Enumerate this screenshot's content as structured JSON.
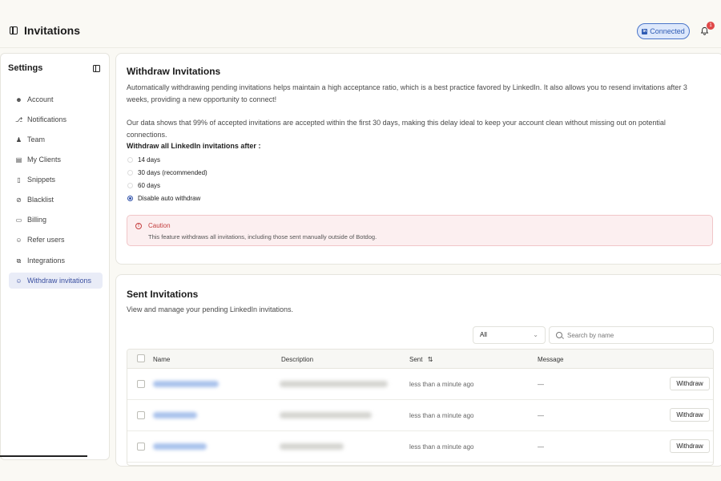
{
  "header": {
    "title": "Invitations",
    "connected_label": "Connected",
    "notification_count": "1"
  },
  "sidebar": {
    "title": "Settings",
    "items": [
      {
        "label": "Account",
        "icon": "user-icon"
      },
      {
        "label": "Notifications",
        "icon": "bell-icon"
      },
      {
        "label": "Team",
        "icon": "team-icon"
      },
      {
        "label": "My Clients",
        "icon": "clients-icon"
      },
      {
        "label": "Snippets",
        "icon": "snippet-icon"
      },
      {
        "label": "Blacklist",
        "icon": "ban-icon"
      },
      {
        "label": "Billing",
        "icon": "card-icon"
      },
      {
        "label": "Refer users",
        "icon": "user-plus-icon"
      },
      {
        "label": "Integrations",
        "icon": "integrations-icon"
      },
      {
        "label": "Withdraw invitations",
        "icon": "user-minus-icon",
        "active": true
      }
    ]
  },
  "withdraw": {
    "title": "Withdraw Invitations",
    "para1": "Automatically withdrawing pending invitations helps maintain a high acceptance ratio, which is a best practice favored by LinkedIn. It also allows you to resend invitations after 3 weeks, providing a new opportunity to connect!",
    "para2": "Our data shows that 99% of accepted invitations are accepted within the first 30 days, making this delay ideal to keep your account clean without missing out on potential connections.",
    "options_label": "Withdraw all LinkedIn invitations after :",
    "options": [
      {
        "label": "14 days",
        "checked": false
      },
      {
        "label": "30 days (recommended)",
        "checked": false
      },
      {
        "label": "60 days",
        "checked": false
      },
      {
        "label": "Disable auto withdraw",
        "checked": true
      }
    ],
    "caution_title": "Caution",
    "caution_text": "This feature withdraws all invitations, including those sent manually outside of Botdog."
  },
  "sent": {
    "title": "Sent Invitations",
    "subtitle": "View and manage your pending LinkedIn invitations.",
    "filter_value": "All",
    "search_placeholder": "Search by name",
    "columns": {
      "name": "Name",
      "description": "Description",
      "sent": "Sent",
      "message": "Message"
    },
    "rows": [
      {
        "sent": "less than a minute ago",
        "message": "—",
        "action": "Withdraw"
      },
      {
        "sent": "less than a minute ago",
        "message": "—",
        "action": "Withdraw"
      },
      {
        "sent": "less than a minute ago",
        "message": "—",
        "action": "Withdraw"
      }
    ]
  },
  "colors": {
    "accent": "#3a4fa0",
    "caution": "#c23c3c",
    "connected": "#2d5bb4"
  }
}
